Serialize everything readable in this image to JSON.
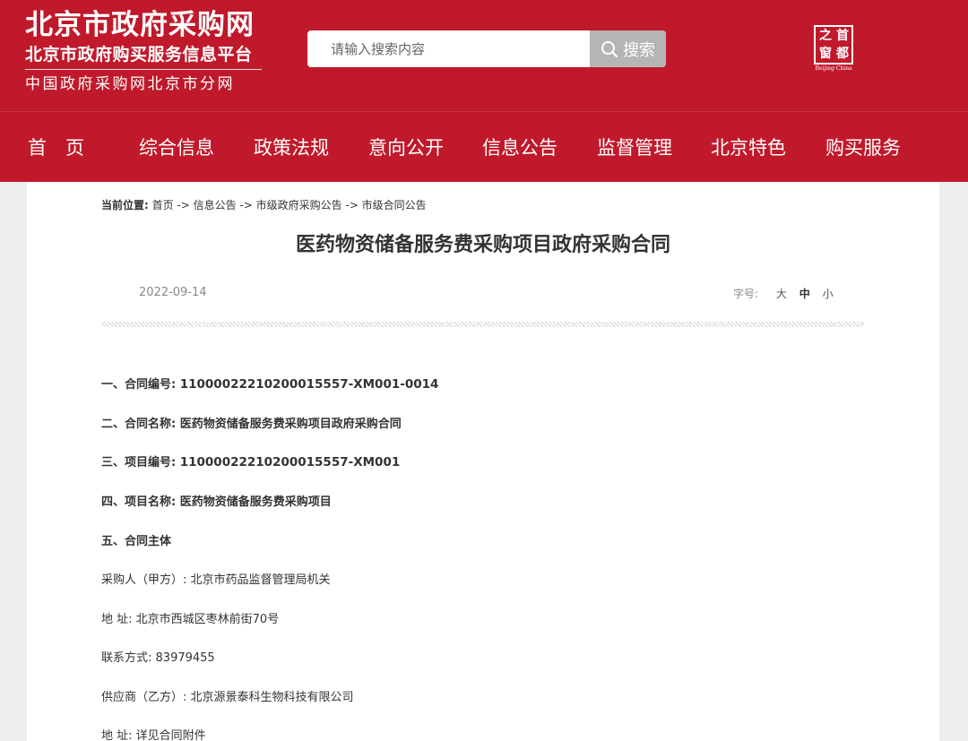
{
  "header": {
    "site_title": "北京市政府采购网",
    "site_subtitle": "北京市政府购买服务信息平台",
    "site_subtitle2": "中国政府采购网北京市分网",
    "seal_chars": [
      "首",
      "都",
      "之",
      "窗"
    ],
    "seal_caption": "Beijing·China",
    "brand_color": "#c0192b"
  },
  "search": {
    "placeholder": "请输入搜索内容",
    "button_label": "搜索",
    "button_icon": "search-icon"
  },
  "nav": {
    "items": [
      {
        "label": "首　页"
      },
      {
        "label": "综合信息"
      },
      {
        "label": "政策法规"
      },
      {
        "label": "意向公开"
      },
      {
        "label": "信息公告"
      },
      {
        "label": "监督管理"
      },
      {
        "label": "北京特色"
      },
      {
        "label": "购买服务"
      }
    ]
  },
  "breadcrumb": {
    "label": "当前位置:",
    "path": "首页 -> 信息公告 -> 市级政府采购公告 -> 市级合同公告"
  },
  "article": {
    "title": "医药物资储备服务费采购项目政府采购合同",
    "date": "2022-09-14",
    "font_size_label": "字号:",
    "font_sizes": [
      "大",
      "中",
      "小"
    ]
  },
  "fields": [
    {
      "label": "一、合同编号:",
      "value": "11000022210200015557-XM001-0014"
    },
    {
      "label": "二、合同名称:",
      "value": "医药物资储备服务费采购项目政府采购合同"
    },
    {
      "label": "三、项目编号:",
      "value": "11000022210200015557-XM001"
    },
    {
      "label": "四、项目名称:",
      "value": "医药物资储备服务费采购项目"
    },
    {
      "label": "五、合同主体",
      "value": ""
    },
    {
      "label": "采购人（甲方）:",
      "value": "北京市药品监督管理局机关"
    },
    {
      "label": "地 址:",
      "value": "北京市西城区枣林前街70号"
    },
    {
      "label": "联系方式:",
      "value": "83979455"
    },
    {
      "label": "供应商（乙方）:",
      "value": "北京源景泰科生物科技有限公司"
    },
    {
      "label": "地 址:",
      "value": "详见合同附件"
    }
  ]
}
